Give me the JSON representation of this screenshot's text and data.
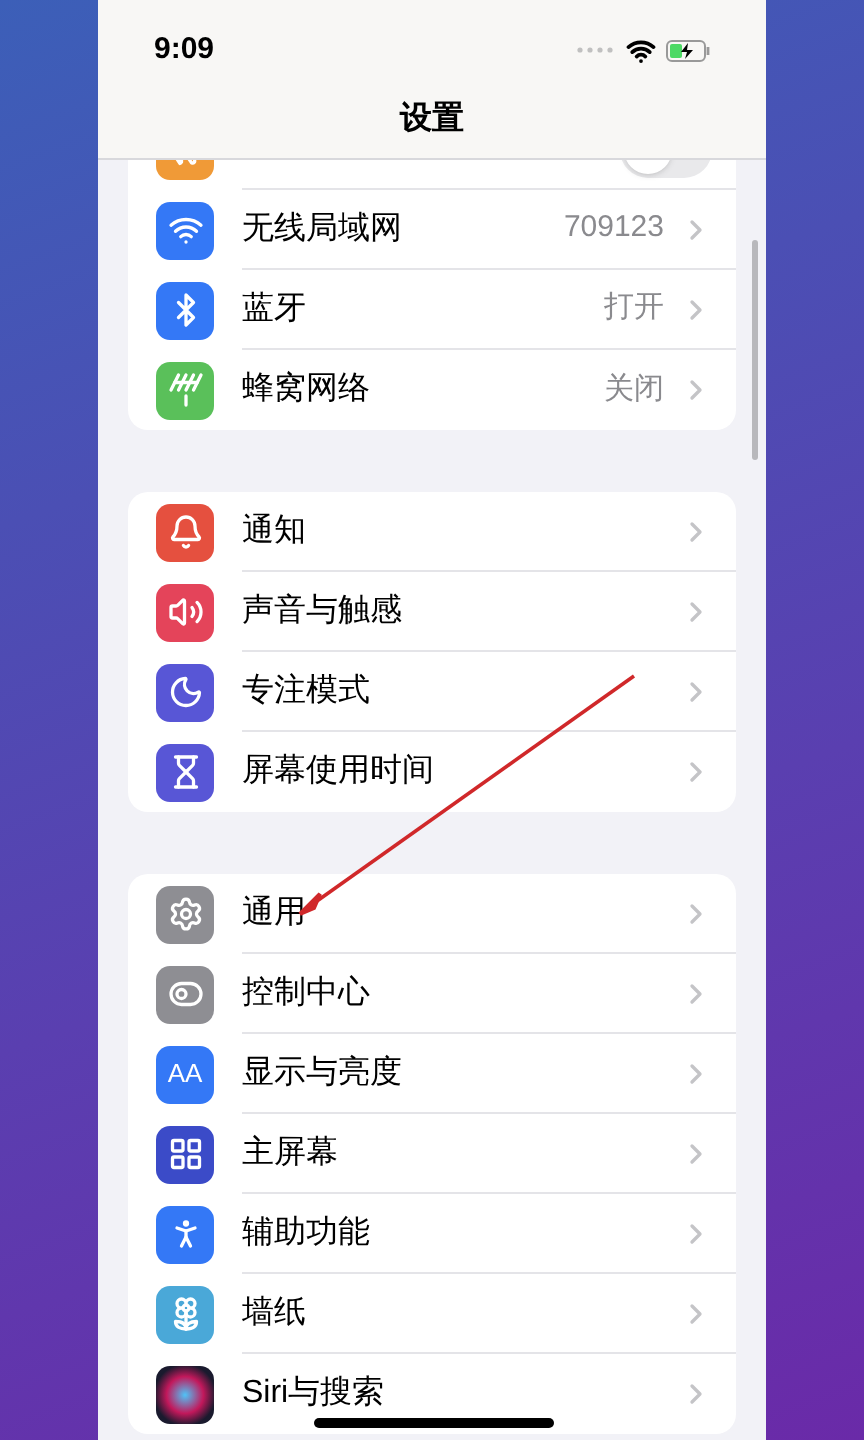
{
  "status_bar": {
    "time": "9:09"
  },
  "title": "设置",
  "groups": [
    {
      "rows": [
        {
          "kind": "toggle",
          "on": false
        },
        {
          "kind": "link",
          "label": "无线局域网",
          "value": "709123"
        },
        {
          "kind": "link",
          "label": "蓝牙",
          "value": "打开"
        },
        {
          "kind": "link",
          "label": "蜂窝网络",
          "value": "关闭"
        }
      ]
    },
    {
      "rows": [
        {
          "kind": "link",
          "label": "通知"
        },
        {
          "kind": "link",
          "label": "声音与触感"
        },
        {
          "kind": "link",
          "label": "专注模式"
        },
        {
          "kind": "link",
          "label": "屏幕使用时间"
        }
      ]
    },
    {
      "rows": [
        {
          "kind": "link",
          "label": "通用"
        },
        {
          "kind": "link",
          "label": "控制中心"
        },
        {
          "kind": "link",
          "label": "显示与亮度",
          "icon_text": "AA"
        },
        {
          "kind": "link",
          "label": "主屏幕"
        },
        {
          "kind": "link",
          "label": "辅助功能"
        },
        {
          "kind": "link",
          "label": "墙纸"
        },
        {
          "kind": "link",
          "label": "Siri与搜索"
        }
      ]
    }
  ]
}
